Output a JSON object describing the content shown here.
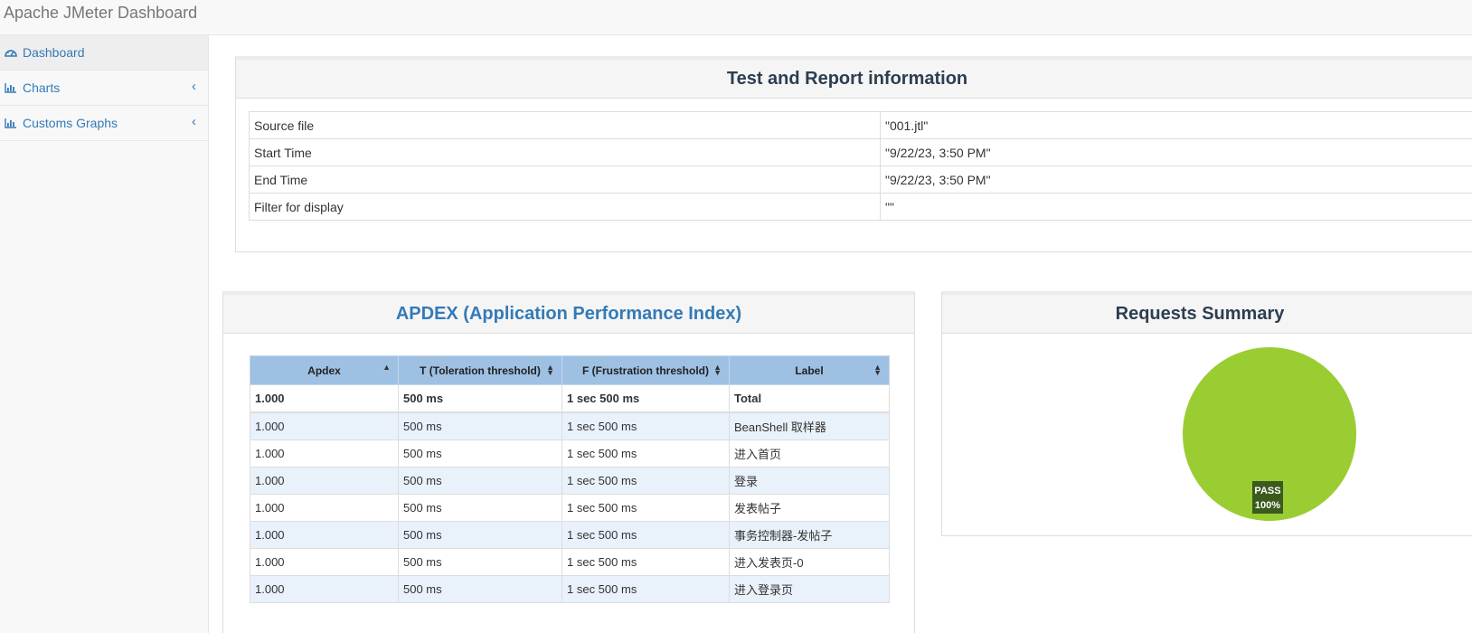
{
  "navbar": {
    "brand": "Apache JMeter Dashboard"
  },
  "sidebar": {
    "items": [
      {
        "label": "Dashboard",
        "icon": "dashboard-icon",
        "active": true
      },
      {
        "label": "Charts",
        "icon": "bar-chart-icon",
        "chevron": "‹"
      },
      {
        "label": "Customs Graphs",
        "icon": "bar-chart-icon",
        "chevron": "‹"
      }
    ]
  },
  "report_info": {
    "title": "Test and Report information",
    "rows": [
      {
        "key": "Source file",
        "value": "\"001.jtl\""
      },
      {
        "key": "Start Time",
        "value": "\"9/22/23, 3:50 PM\""
      },
      {
        "key": "End Time",
        "value": "\"9/22/23, 3:50 PM\""
      },
      {
        "key": "Filter for display",
        "value": "\"\""
      }
    ]
  },
  "apdex": {
    "title": "APDEX (Application Performance Index)",
    "title_color": "#337ab7",
    "columns": [
      "Apdex",
      "T (Toleration threshold)",
      "F (Frustration threshold)",
      "Label"
    ],
    "total": [
      "1.000",
      "500 ms",
      "1 sec 500 ms",
      "Total"
    ],
    "rows": [
      [
        "1.000",
        "500 ms",
        "1 sec 500 ms",
        "BeanShell 取样器"
      ],
      [
        "1.000",
        "500 ms",
        "1 sec 500 ms",
        "进入首页"
      ],
      [
        "1.000",
        "500 ms",
        "1 sec 500 ms",
        "登录"
      ],
      [
        "1.000",
        "500 ms",
        "1 sec 500 ms",
        "发表帖子"
      ],
      [
        "1.000",
        "500 ms",
        "1 sec 500 ms",
        "事务控制器-发帖子"
      ],
      [
        "1.000",
        "500 ms",
        "1 sec 500 ms",
        "进入发表页-0"
      ],
      [
        "1.000",
        "500 ms",
        "1 sec 500 ms",
        "进入登录页"
      ]
    ]
  },
  "requests_summary": {
    "title": "Requests Summary",
    "slices": [
      {
        "label": "PASS",
        "percent": "100%",
        "value": 100,
        "color": "#9acd32"
      }
    ],
    "label_bg": "#3b5a1e"
  }
}
